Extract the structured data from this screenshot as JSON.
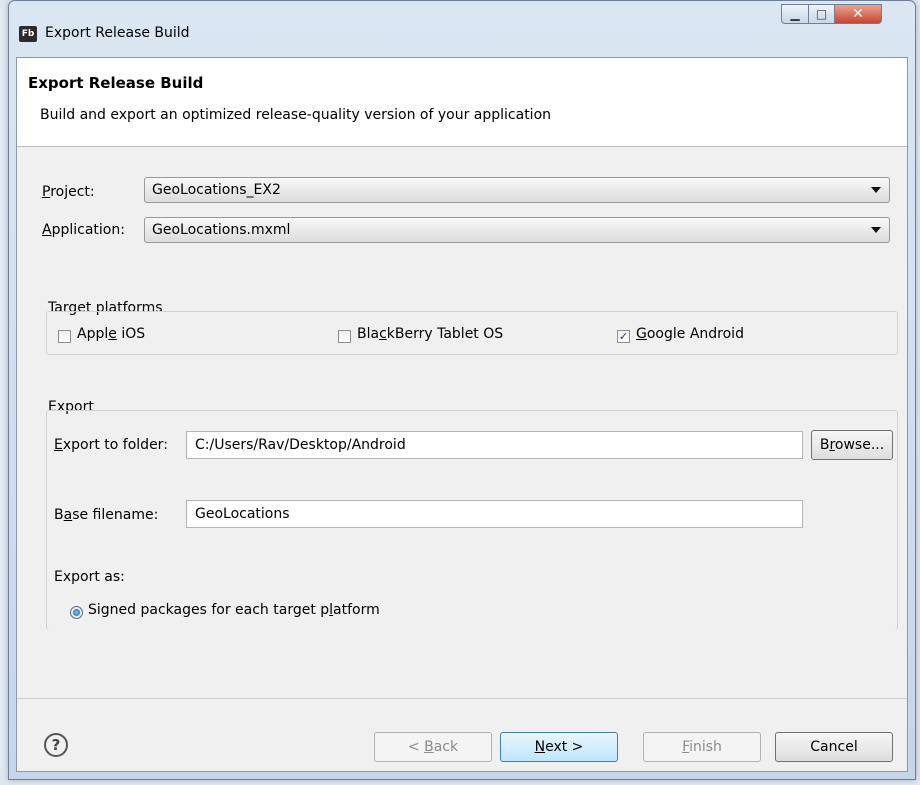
{
  "window": {
    "title": "Export Release Build",
    "icon_text": "Fb",
    "controls": {
      "minimize_icon": "minimize-icon",
      "maximize_icon": "maximize-icon",
      "close_icon": "close-icon"
    }
  },
  "banner": {
    "title": "Export Release Build",
    "description": "Build and export an optimized release-quality version of your application"
  },
  "form": {
    "project": {
      "label": "Project:",
      "value": "GeoLocations_EX2"
    },
    "application": {
      "label": "Application:",
      "value": "GeoLocations.mxml"
    }
  },
  "target_platforms": {
    "legend": "Target platforms",
    "options": [
      {
        "label": "Apple iOS",
        "checked": false
      },
      {
        "label": "BlackBerry Tablet OS",
        "checked": false
      },
      {
        "label": "Google Android",
        "checked": true
      }
    ]
  },
  "export": {
    "legend": "Export",
    "folder_label": "Export to folder:",
    "folder_value": "C:/Users/Rav/Desktop/Android",
    "browse_label": "Browse...",
    "base_filename_label": "Base filename:",
    "base_filename_value": "GeoLocations",
    "export_as_label": "Export as:",
    "radio_label": "Signed packages for each target platform",
    "radio_selected": true
  },
  "footer": {
    "help_icon": "help-icon",
    "back_label": "< Back",
    "next_label": "Next >",
    "finish_label": "Finish",
    "cancel_label": "Cancel"
  }
}
